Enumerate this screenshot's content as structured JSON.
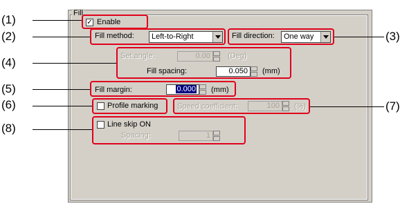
{
  "group_title": "Fill",
  "enable": {
    "label": "Enable",
    "checked": true
  },
  "fill_method": {
    "label": "Fill method:",
    "value": "Left-to-Right"
  },
  "fill_direction": {
    "label": "Fill direction:",
    "value": "One way"
  },
  "set_angle": {
    "label": "Set angle:",
    "value": "0.00",
    "unit": "(Deg)",
    "enabled": false
  },
  "fill_spacing": {
    "label": "Fill spacing:",
    "value": "0.050",
    "unit": "(mm)"
  },
  "fill_margin": {
    "label": "Fill margin:",
    "value": "0.000",
    "unit": "(mm)"
  },
  "profile_marking": {
    "label": "Profile marking",
    "checked": false
  },
  "speed_coefficient": {
    "label": "Speed coefficient:",
    "value": "100",
    "unit": "(%)",
    "enabled": false
  },
  "line_skip": {
    "label": "Line skip ON",
    "checked": false
  },
  "spacing": {
    "label": "Spacing:",
    "value": "1",
    "enabled": false
  },
  "callouts": [
    "(1)",
    "(2)",
    "(3)",
    "(4)",
    "(5)",
    "(6)",
    "(7)",
    "(8)"
  ],
  "colors": {
    "panel": "#d4d0c8",
    "highlight": "#e0001b",
    "selection": "#000080"
  }
}
